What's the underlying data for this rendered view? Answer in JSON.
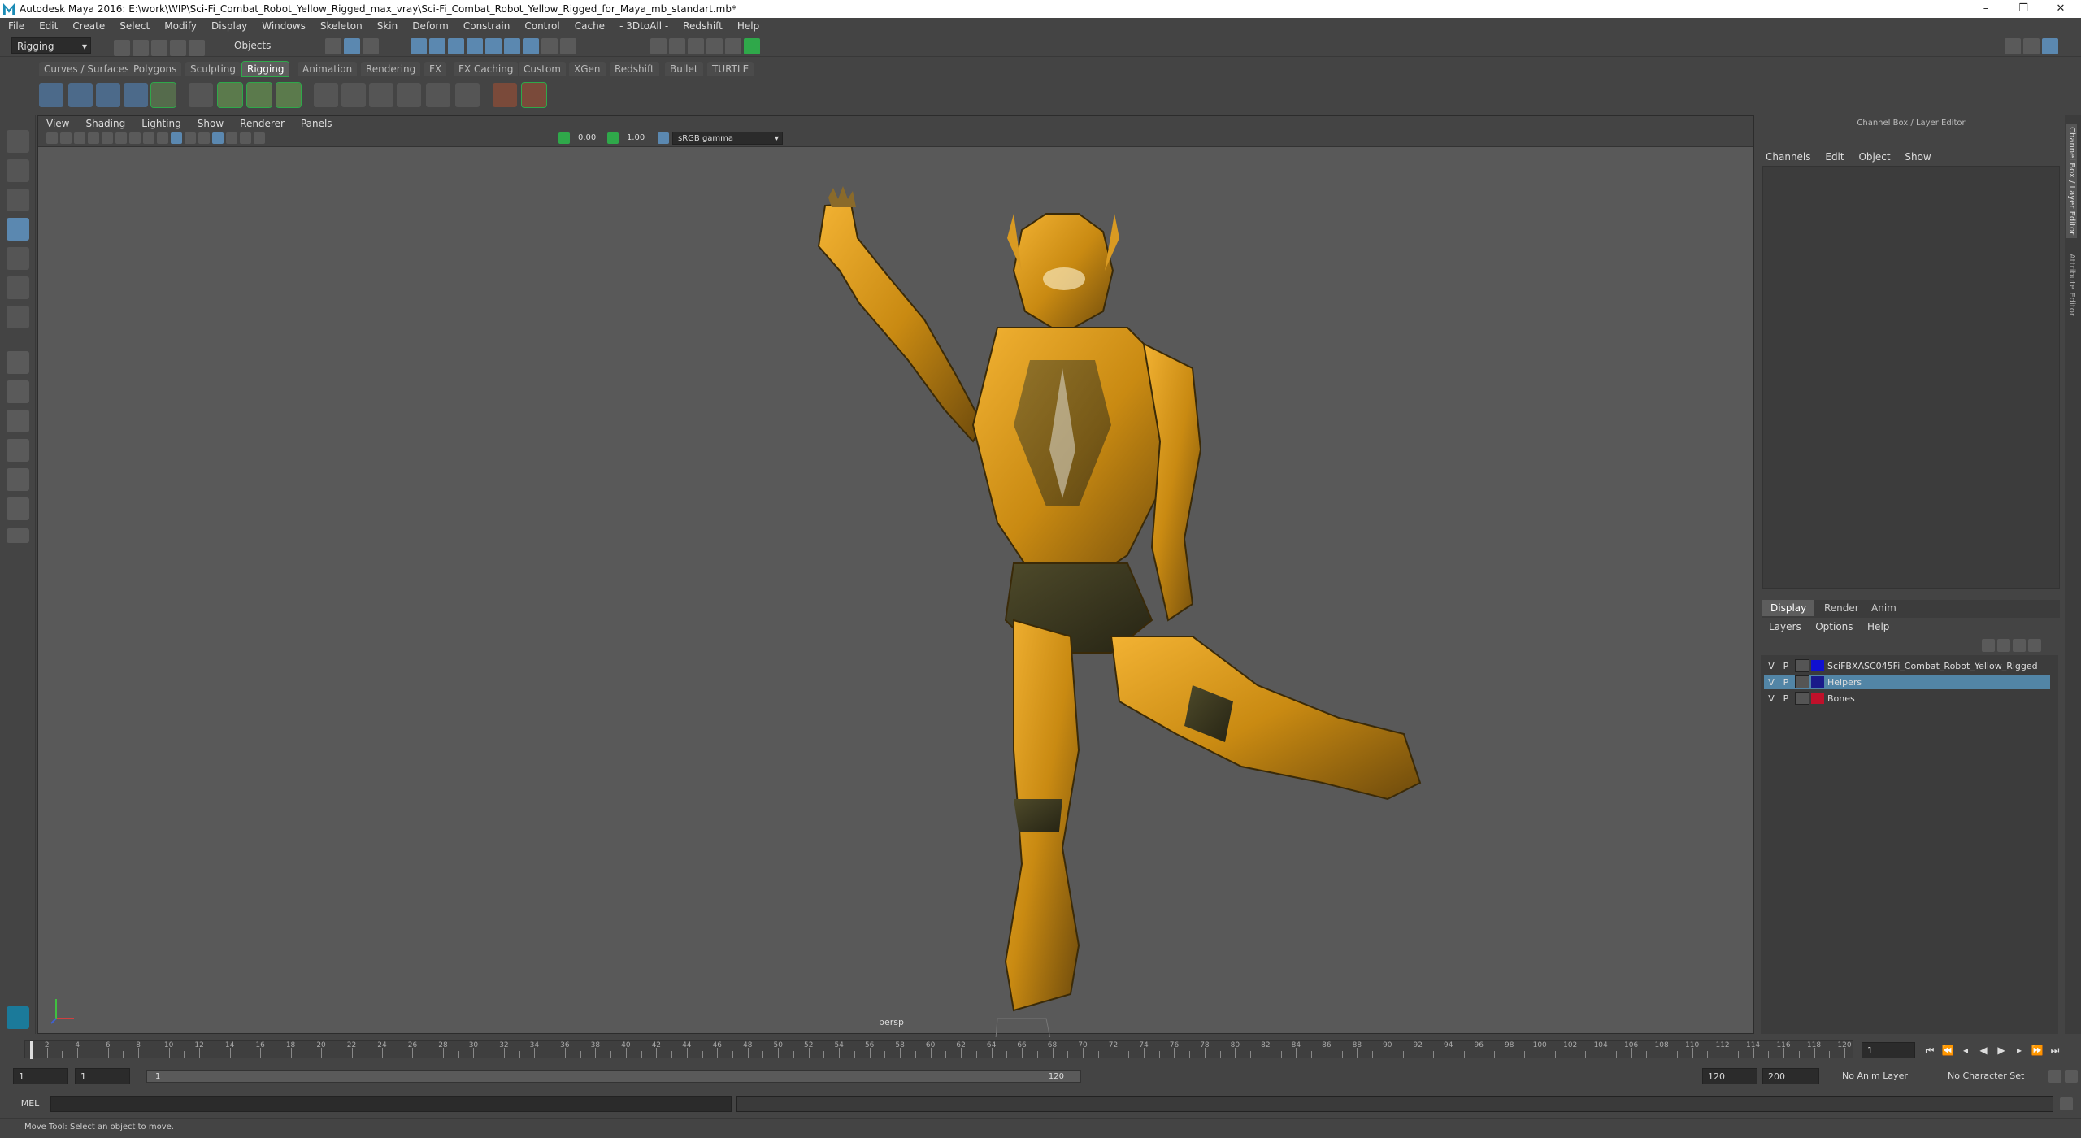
{
  "window": {
    "title": "Autodesk Maya 2016: E:\\work\\WIP\\Sci-Fi_Combat_Robot_Yellow_Rigged_max_vray\\Sci-Fi_Combat_Robot_Yellow_Rigged_for_Maya_mb_standart.mb*",
    "controls": [
      "–",
      "❐",
      "✕"
    ]
  },
  "menubar": [
    "File",
    "Edit",
    "Create",
    "Select",
    "Modify",
    "Display",
    "Windows",
    "Skeleton",
    "Skin",
    "Deform",
    "Constrain",
    "Control",
    "Cache",
    "- 3DtoAll -",
    "Redshift",
    "Help"
  ],
  "statusline": {
    "menuset": "Rigging",
    "selection_mode": "Objects"
  },
  "shelf_tabs": [
    "Curves / Surfaces",
    "Polygons",
    "Sculpting",
    "Rigging",
    "Animation",
    "Rendering",
    "FX",
    "FX Caching",
    "Custom",
    "XGen",
    "Redshift",
    "Bullet",
    "TURTLE"
  ],
  "shelf_active": "Rigging",
  "viewport": {
    "menu": [
      "View",
      "Shading",
      "Lighting",
      "Show",
      "Renderer",
      "Panels"
    ],
    "exposure": "0.00",
    "gamma": "1.00",
    "color_space": "sRGB gamma",
    "camera_label": "persp"
  },
  "channel_box": {
    "title": "Channel Box / Layer Editor",
    "menu": [
      "Channels",
      "Edit",
      "Object",
      "Show"
    ]
  },
  "layer_editor": {
    "tabs": [
      "Display",
      "Render",
      "Anim"
    ],
    "active_tab": "Display",
    "menu": [
      "Layers",
      "Options",
      "Help"
    ],
    "layers": [
      {
        "v": "V",
        "p": "P",
        "color": "#1010d0",
        "name": "SciFBXASC045Fi_Combat_Robot_Yellow_Rigged",
        "selected": false
      },
      {
        "v": "V",
        "p": "P",
        "color": "#1a1a8a",
        "name": "Helpers",
        "selected": true
      },
      {
        "v": "V",
        "p": "P",
        "color": "#c0102a",
        "name": "Bones",
        "selected": false
      }
    ]
  },
  "side_tabs": [
    "Channel Box / Layer Editor",
    "Attribute Editor"
  ],
  "time_slider": {
    "tick_labels": [
      "2",
      "4",
      "6",
      "8",
      "10",
      "12",
      "14",
      "16",
      "18",
      "20",
      "22",
      "24",
      "26",
      "28",
      "30",
      "32",
      "34",
      "36",
      "38",
      "40",
      "42",
      "44",
      "46",
      "48",
      "50",
      "52",
      "54",
      "56",
      "58",
      "60",
      "62",
      "64",
      "66",
      "68",
      "70",
      "72",
      "74",
      "76",
      "78",
      "80",
      "82",
      "84",
      "86",
      "88",
      "90",
      "92",
      "94",
      "96",
      "98",
      "100",
      "102",
      "104",
      "106",
      "108",
      "110",
      "112",
      "114",
      "116",
      "118",
      "120"
    ],
    "start_tick": "1",
    "current_frame": "1"
  },
  "range_slider": {
    "start": "1",
    "playback_start": "1",
    "range_start_label": "1",
    "range_end_label": "120",
    "playback_end": "120",
    "end": "200",
    "anim_layer": "No Anim Layer",
    "character_set": "No Character Set"
  },
  "command_line": {
    "language": "MEL"
  },
  "help_line": "Move Tool: Select an object to move.",
  "colors": {
    "accent_green": "#2fa84a",
    "select_blue": "#5285a6",
    "robot_gold": "#c98a12"
  }
}
